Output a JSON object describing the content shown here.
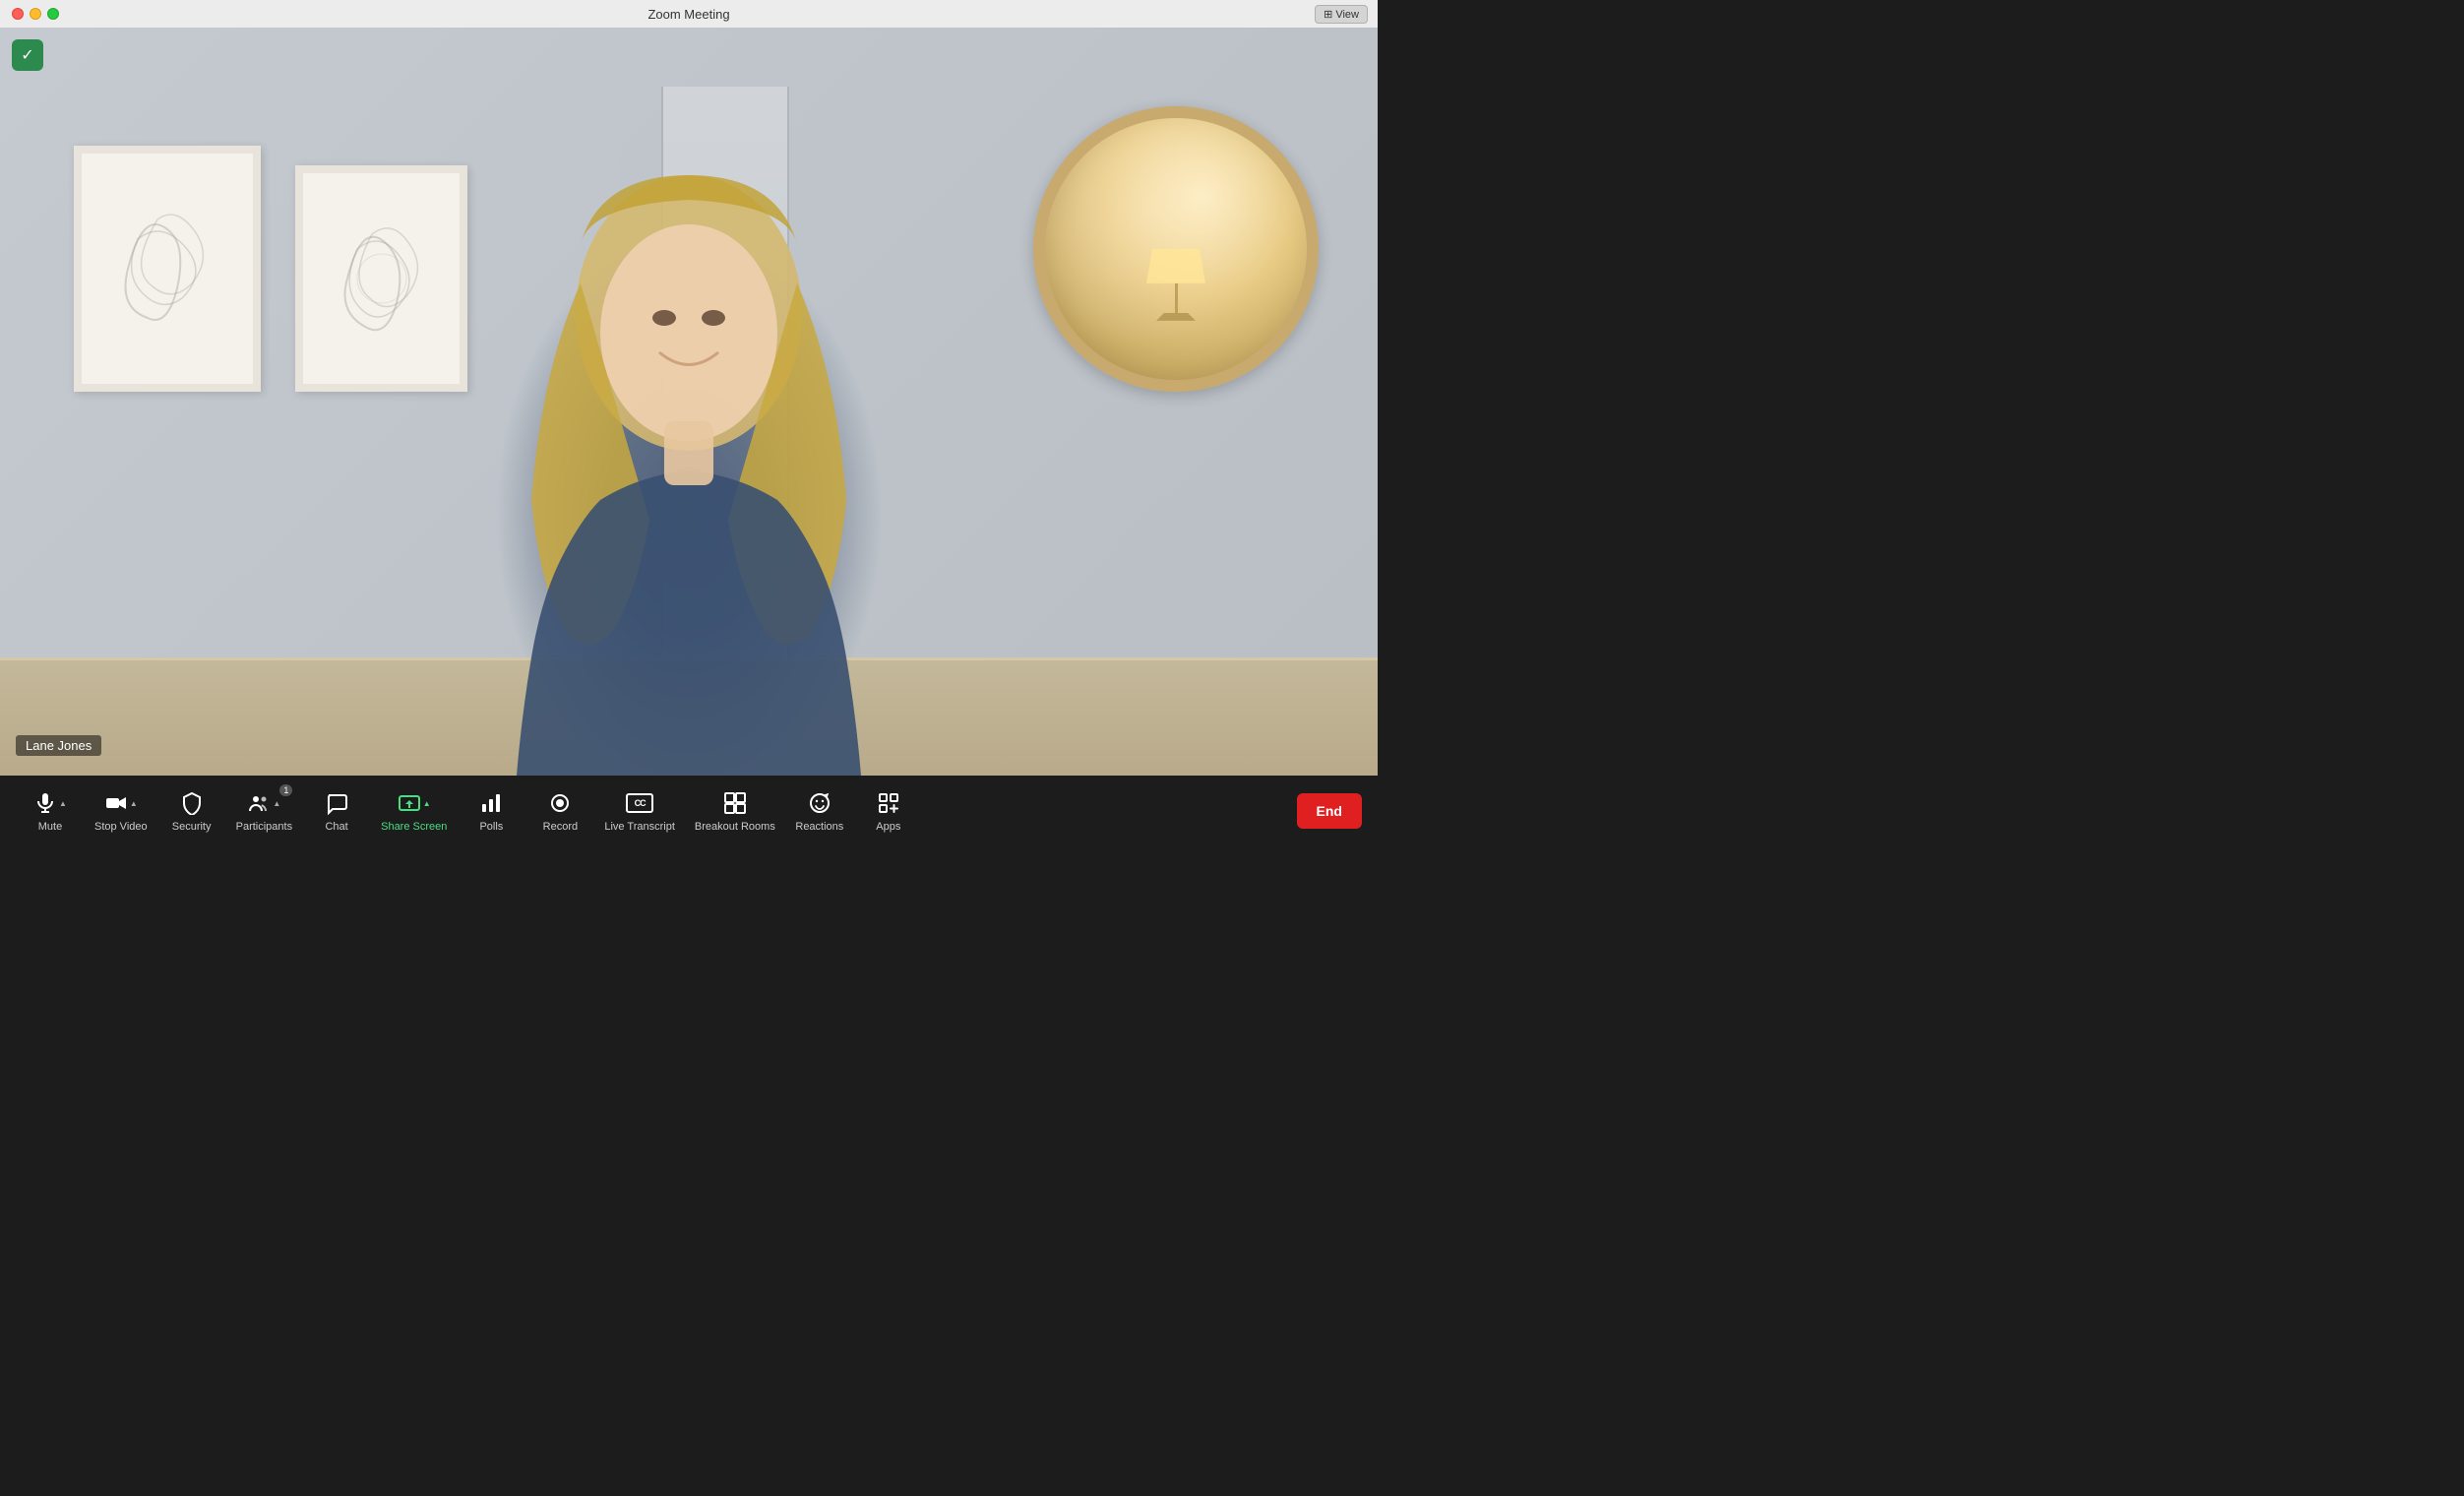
{
  "titlebar": {
    "title": "Zoom Meeting",
    "view_button": "⊞ View"
  },
  "toolbar": {
    "items": [
      {
        "id": "mute",
        "label": "Mute",
        "icon": "mic",
        "has_arrow": true,
        "active": false
      },
      {
        "id": "stop-video",
        "label": "Stop Video",
        "icon": "video",
        "has_arrow": true,
        "active": false
      },
      {
        "id": "security",
        "label": "Security",
        "icon": "shield",
        "has_arrow": false,
        "active": false
      },
      {
        "id": "participants",
        "label": "Participants",
        "icon": "participants",
        "has_arrow": true,
        "active": false,
        "count": "1"
      },
      {
        "id": "chat",
        "label": "Chat",
        "icon": "chat",
        "has_arrow": false,
        "active": false
      },
      {
        "id": "share-screen",
        "label": "Share Screen",
        "icon": "share",
        "has_arrow": true,
        "active": true
      },
      {
        "id": "polls",
        "label": "Polls",
        "icon": "polls",
        "has_arrow": false,
        "active": false
      },
      {
        "id": "record",
        "label": "Record",
        "icon": "record",
        "has_arrow": false,
        "active": false
      },
      {
        "id": "live-transcript",
        "label": "Live Transcript",
        "icon": "cc",
        "has_arrow": false,
        "active": false
      },
      {
        "id": "breakout-rooms",
        "label": "Breakout Rooms",
        "icon": "breakout",
        "has_arrow": false,
        "active": false
      },
      {
        "id": "reactions",
        "label": "Reactions",
        "icon": "reactions",
        "has_arrow": false,
        "active": false
      },
      {
        "id": "apps",
        "label": "Apps",
        "icon": "apps",
        "has_arrow": false,
        "active": false
      }
    ],
    "end_label": "End"
  },
  "video": {
    "participant_name": "Lane Jones",
    "shield_icon": "✓"
  }
}
